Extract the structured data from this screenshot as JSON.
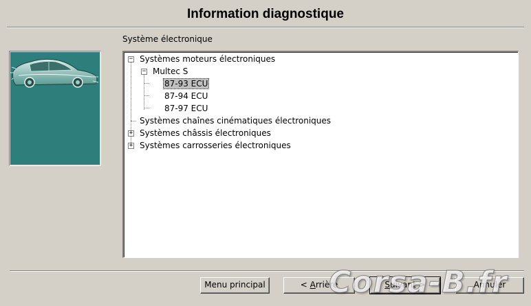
{
  "window": {
    "title": "Information diagnostique"
  },
  "group_label": "Système électronique",
  "tree": {
    "nodes": [
      {
        "label": "Systèmes moteurs électroniques",
        "expander": "−"
      },
      {
        "label": "Multec S",
        "expander": "−"
      },
      {
        "label": "87-93 ECU",
        "selected": true
      },
      {
        "label": "87-94 ECU"
      },
      {
        "label": "87-97 ECU"
      },
      {
        "label": "Systèmes chaînes cinématiques électroniques"
      },
      {
        "label": "Systèmes châssis électroniques",
        "expander": "+"
      },
      {
        "label": "Systèmes carrosseries électroniques",
        "expander": "+"
      }
    ]
  },
  "buttons": {
    "menu": "Menu principal",
    "back_prefix": "< ",
    "back_underlined": "A",
    "back_rest": "rrière",
    "next_underlined": "S",
    "next_rest": "uivant >",
    "cancel": "Annuler"
  },
  "watermark": "Corsa-B.fr",
  "colors": {
    "panel_bg": "#d4d0c8",
    "image_bg": "#2e7f7b",
    "tree_bg": "#ffffff"
  }
}
